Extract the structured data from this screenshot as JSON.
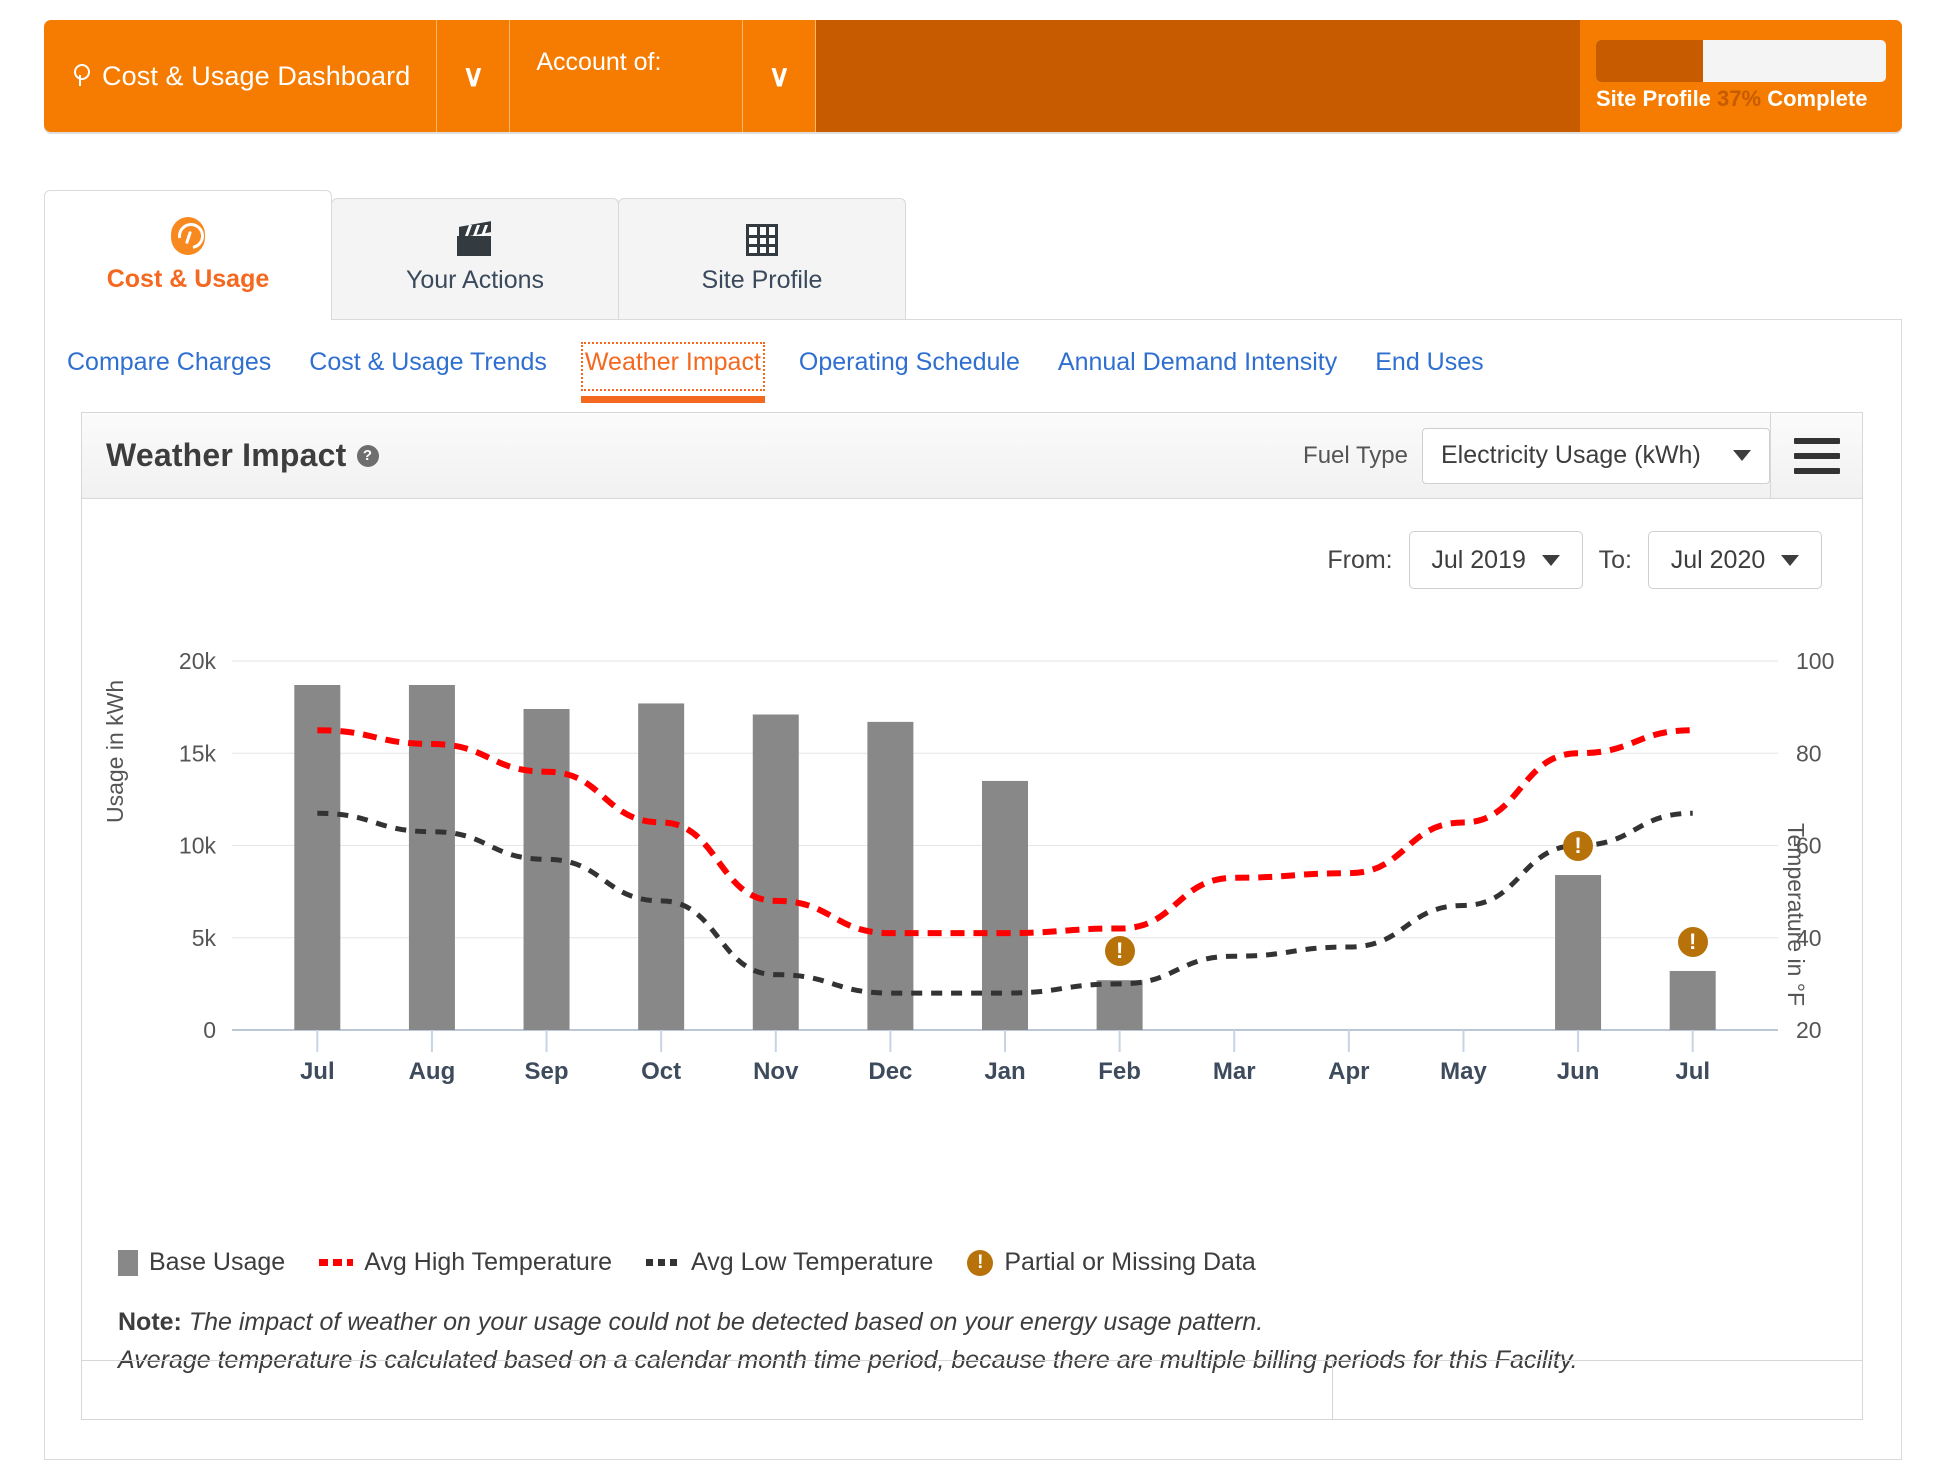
{
  "topbar": {
    "dashboard_title": "Cost & Usage Dashboard",
    "dashboard_icon": "lightbulb-icon",
    "dashboard_caret": "∨",
    "account_label": "Account of:",
    "account_caret": "∨",
    "site_profile_prefix": "Site Profile",
    "site_profile_percent": "37%",
    "site_profile_suffix": "Complete",
    "site_profile_progress": 37,
    "accent_color": "#F57C00",
    "accent_dark_color": "#C75B00"
  },
  "primary_tabs": [
    {
      "label": "Cost & Usage",
      "icon": "gauge-icon",
      "active": true
    },
    {
      "label": "Your Actions",
      "icon": "clapperboard-icon",
      "active": false
    },
    {
      "label": "Site Profile",
      "icon": "grid-icon",
      "active": false
    }
  ],
  "subnav": [
    {
      "label": "Compare Charges",
      "active": false
    },
    {
      "label": "Cost & Usage Trends",
      "active": false
    },
    {
      "label": "Weather Impact",
      "active": true
    },
    {
      "label": "Operating Schedule",
      "active": false
    },
    {
      "label": "Annual Demand Intensity",
      "active": false
    },
    {
      "label": "End Uses",
      "active": false
    }
  ],
  "panel": {
    "title": "Weather Impact",
    "help_icon": "question-mark-icon",
    "fuel_type_label": "Fuel Type",
    "fuel_type_value": "Electricity Usage (kWh)",
    "menu_icon": "hamburger-menu-icon",
    "from_label": "From:",
    "from_value": "Jul 2019",
    "to_label": "To:",
    "to_value": "Jul 2020"
  },
  "legend": [
    {
      "label": "Base Usage",
      "marker": "bar-swatch",
      "color": "#888888"
    },
    {
      "label": "Avg High Temperature",
      "marker": "red-dashed-line",
      "color": "#FF0000"
    },
    {
      "label": "Avg Low Temperature",
      "marker": "dark-dashed-line",
      "color": "#333333"
    },
    {
      "label": "Partial or Missing Data",
      "marker": "warning-icon",
      "color": "#B8720A"
    }
  ],
  "note": {
    "prefix": "Note:",
    "line1": "The impact of weather on your usage could not be detected based on your energy usage pattern.",
    "line2": "Average temperature is calculated based on a calendar month time period, because there are multiple billing periods for this Facility."
  },
  "chart_data": {
    "type": "bar",
    "title": "Weather Impact",
    "xlabel": "",
    "ylabel": "Usage in kWh",
    "y2label": "Temperature in °F",
    "ylim": [
      0,
      20000
    ],
    "y2lim": [
      20,
      100
    ],
    "yticks": [
      "0",
      "5k",
      "10k",
      "15k",
      "20k"
    ],
    "ytick_values": [
      0,
      5000,
      10000,
      15000,
      20000
    ],
    "y2ticks": [
      "20",
      "40",
      "60",
      "80",
      "100"
    ],
    "y2tick_values": [
      20,
      40,
      60,
      80,
      100
    ],
    "grid": true,
    "legend_position": "bottom-left",
    "categories": [
      "Jul",
      "Aug",
      "Sep",
      "Oct",
      "Nov",
      "Dec",
      "Jan",
      "Feb",
      "Mar",
      "Apr",
      "May",
      "Jun",
      "Jul"
    ],
    "series": [
      {
        "name": "Base Usage",
        "type": "bar",
        "axis": "left",
        "unit": "kWh",
        "color": "#888888",
        "values": [
          18700,
          18700,
          17400,
          17700,
          17100,
          16700,
          13500,
          2700,
          null,
          null,
          null,
          8400,
          3200
        ]
      },
      {
        "name": "Avg High Temperature",
        "type": "line",
        "style": "dashed",
        "axis": "right",
        "unit": "°F",
        "color": "#FF0000",
        "values": [
          85,
          82,
          76,
          65,
          48,
          41,
          41,
          42,
          53,
          54,
          65,
          80,
          85
        ]
      },
      {
        "name": "Avg Low Temperature",
        "type": "line",
        "style": "dashed",
        "axis": "right",
        "unit": "°F",
        "color": "#333333",
        "values": [
          67,
          63,
          57,
          48,
          32,
          28,
          28,
          30,
          36,
          38,
          47,
          60,
          67
        ]
      }
    ],
    "annotations": [
      {
        "category": "Feb",
        "label": "Partial or Missing Data",
        "icon": "warning-icon"
      },
      {
        "category": "Jun",
        "label": "Partial or Missing Data",
        "icon": "warning-icon"
      },
      {
        "category": "Jul",
        "label": "Partial or Missing Data",
        "icon": "warning-icon"
      }
    ]
  }
}
